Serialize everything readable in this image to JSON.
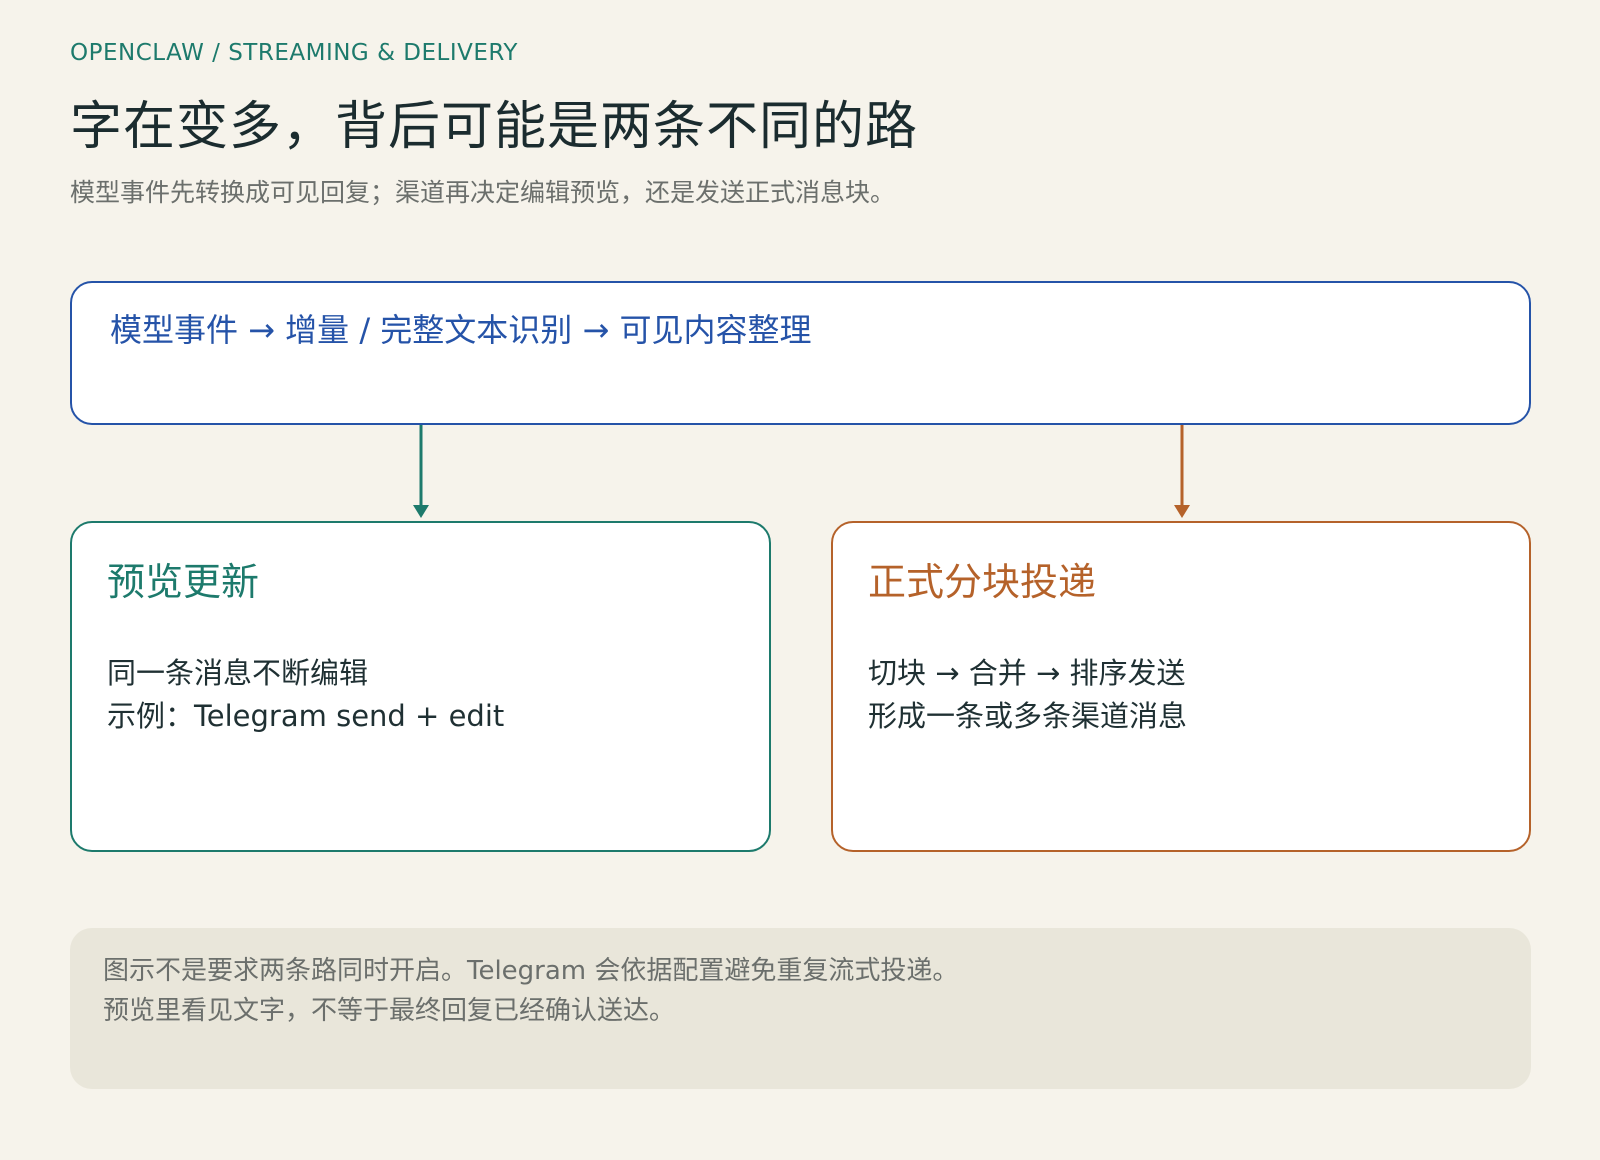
{
  "header": {
    "eyebrow": "OPENCLAW  /  STREAMING & DELIVERY",
    "title": "字在变多，背后可能是两条不同的路",
    "subtitle": "模型事件先转换成可见回复；渠道再决定编辑预览，还是发送正式消息块。"
  },
  "pipeline": {
    "text": "模型事件 → 增量 / 完整文本识别 → 可见内容整理"
  },
  "preview_box": {
    "title": "预览更新",
    "line1": "同一条消息不断编辑",
    "line2": "示例：Telegram send + edit"
  },
  "delivery_box": {
    "title": "正式分块投递",
    "line1": "切块 → 合并 → 排序发送",
    "line2": "形成一条或多条渠道消息"
  },
  "note": {
    "line1": "图示不是要求两条路同时开启。Telegram 会依据配置避免重复流式投递。",
    "line2": "预览里看见文字，不等于最终回复已经确认送达。"
  },
  "colors": {
    "background": "#f6f3eb",
    "pipeline_accent": "#2553a8",
    "preview_accent": "#1d7a6c",
    "delivery_accent": "#b5622a",
    "note_background": "#e9e6da"
  }
}
